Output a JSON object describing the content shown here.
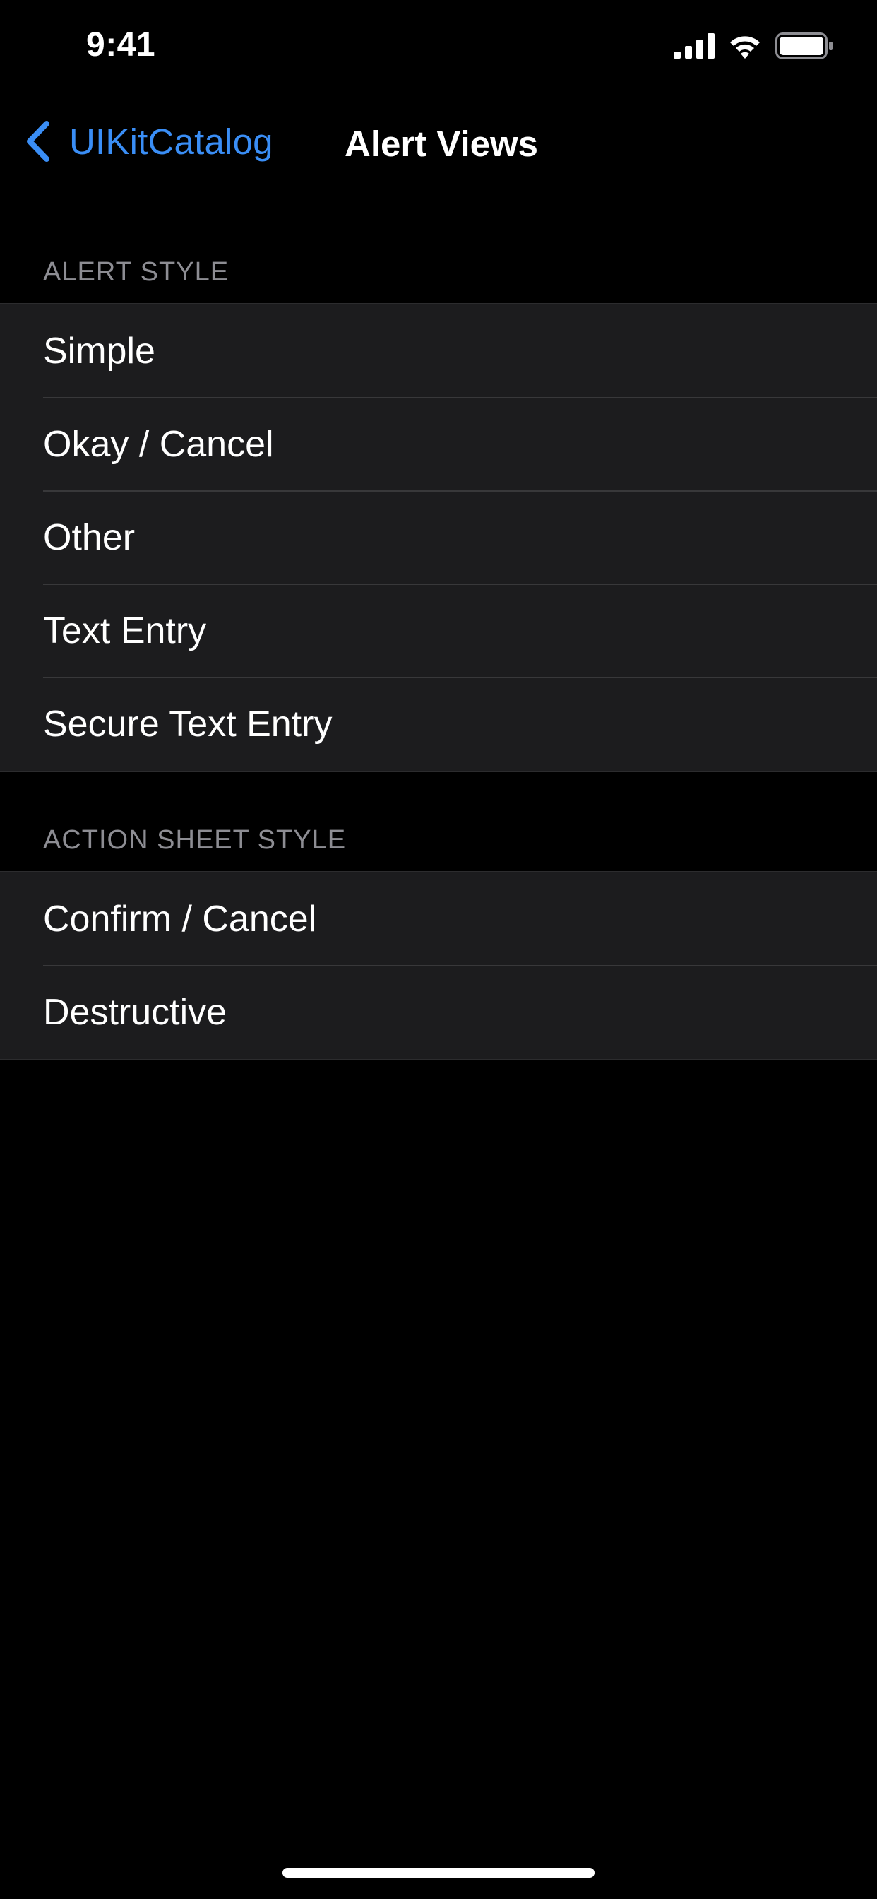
{
  "status_bar": {
    "time": "9:41",
    "icons": [
      "cellular-signal-icon",
      "wifi-icon",
      "battery-icon"
    ]
  },
  "nav_bar": {
    "back_label": "UIKitCatalog",
    "back_icon": "chevron-left-icon",
    "title": "Alert Views"
  },
  "sections": [
    {
      "header": "ALERT STYLE",
      "rows": [
        "Simple",
        "Okay / Cancel",
        "Other",
        "Text Entry",
        "Secure Text Entry"
      ]
    },
    {
      "header": "ACTION SHEET STYLE",
      "rows": [
        "Confirm / Cancel",
        "Destructive"
      ]
    }
  ],
  "colors": {
    "background": "#000000",
    "cell_background": "#1c1c1e",
    "accent": "#3a8ef6",
    "secondary_label": "#8d8d93"
  }
}
